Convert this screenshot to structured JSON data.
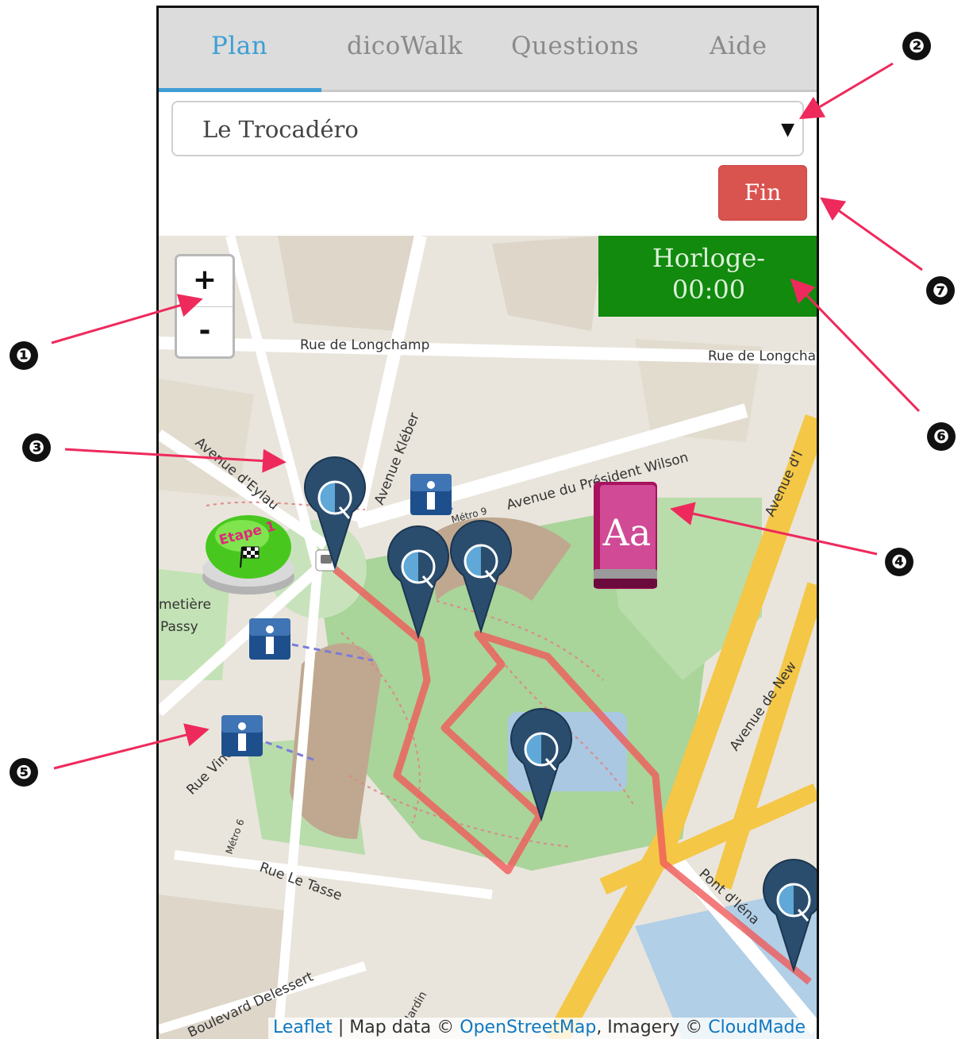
{
  "tabs": [
    {
      "label": "Plan",
      "active": true
    },
    {
      "label": "dicoWalk",
      "active": false
    },
    {
      "label": "Questions",
      "active": false
    },
    {
      "label": "Aide",
      "active": false
    }
  ],
  "location_select": {
    "value": "Le Trocadéro"
  },
  "fin_button": {
    "label": "Fin"
  },
  "map": {
    "zoom_in": "+",
    "zoom_out": "-",
    "clock_label": "Horloge-",
    "clock_time": "00:00",
    "stage_marker": "Etape 1",
    "dictionary_icon_text": "Aa",
    "info_marker": "i",
    "streets": {
      "longchamp_left": "Rue de Longchamp",
      "longchamp_right": "Rue de Longcha",
      "kleber": "Avenue Kléber",
      "wilson": "Avenue du Président Wilson",
      "metro9": "Métro 9",
      "eylau": "Avenue d'Eylau",
      "cimetiere": "metière",
      "passy": "Passy",
      "avenue_d": "Avenue d'I",
      "new_york": "Avenue de New",
      "vineuse": "Rue Vineuse",
      "metro6": "Métro 6",
      "le_tasse": "Rue Le Tasse",
      "pont": "Pont d'Iéna",
      "delessert": "Boulevard Delessert",
      "jardin": "Jardin"
    },
    "attribution": {
      "leaflet": "Leaflet",
      "sep1": " | Map data © ",
      "osm": "OpenStreetMap",
      "sep2": ", Imagery © ",
      "cloudmade": "CloudMade"
    }
  },
  "callouts": [
    "❶",
    "❷",
    "❸",
    "❹",
    "❺",
    "❻",
    "❼"
  ],
  "colors": {
    "tab_active": "#3d9ed4",
    "fin_button": "#d9534f",
    "clock_bg": "#118a0e",
    "route": "#f05a5a",
    "marker": "#2a4d6e",
    "arrow": "#ee2a5c"
  }
}
